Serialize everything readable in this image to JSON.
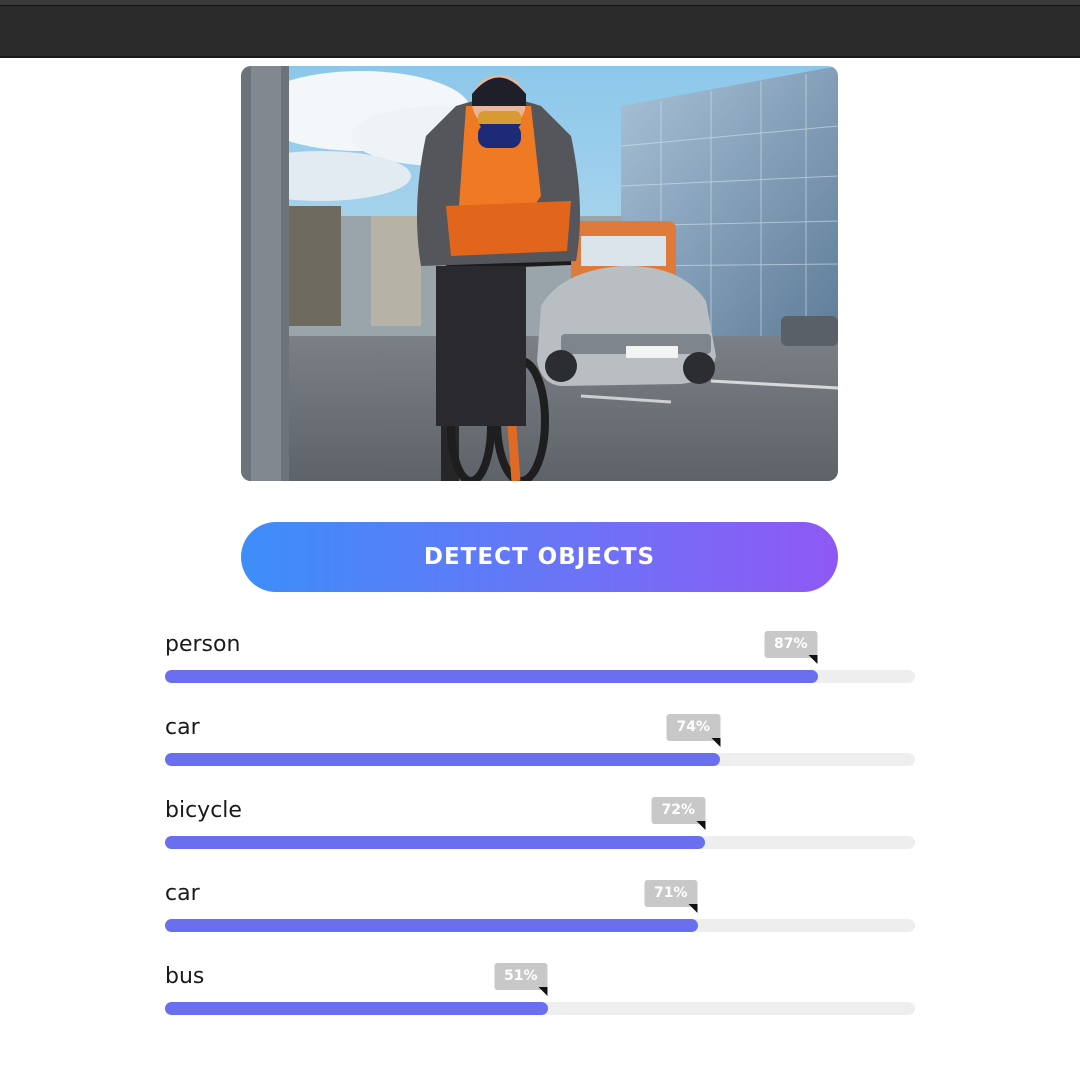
{
  "photo": {
    "subject": "cyclist-on-city-street"
  },
  "detect_button": {
    "label": "DETECT OBJECTS"
  },
  "colors": {
    "bar_fill": "#6a6ff0",
    "bar_track": "#eeeeee",
    "tooltip_bg": "#c8c8c8",
    "button_gradient_start": "#3d8ef9",
    "button_gradient_end": "#8f58f5"
  },
  "results": [
    {
      "label": "person",
      "percent_text": "87%",
      "percent": 87
    },
    {
      "label": "car",
      "percent_text": "74%",
      "percent": 74
    },
    {
      "label": "bicycle",
      "percent_text": "72%",
      "percent": 72
    },
    {
      "label": "car",
      "percent_text": "71%",
      "percent": 71
    },
    {
      "label": "bus",
      "percent_text": "51%",
      "percent": 51
    }
  ]
}
